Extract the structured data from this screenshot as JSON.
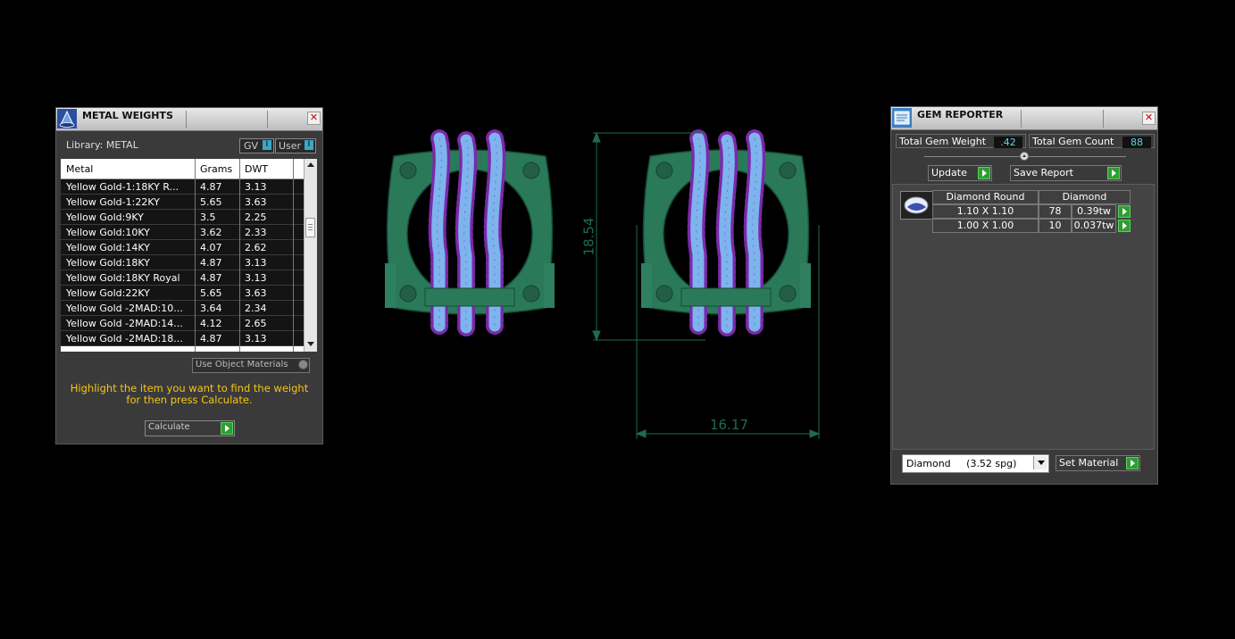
{
  "metal_panel": {
    "title": "METAL WEIGHTS",
    "library_label": "Library: METAL",
    "gv_label": "GV",
    "user_label": "User",
    "columns": [
      "Metal",
      "Grams",
      "DWT"
    ],
    "rows": [
      {
        "metal": "Yellow Gold-1:18KY R...",
        "grams": "4.87",
        "dwt": "3.13"
      },
      {
        "metal": "Yellow Gold-1:22KY",
        "grams": "5.65",
        "dwt": "3.63"
      },
      {
        "metal": "Yellow Gold:9KY",
        "grams": "3.5",
        "dwt": "2.25"
      },
      {
        "metal": "Yellow Gold:10KY",
        "grams": "3.62",
        "dwt": "2.33"
      },
      {
        "metal": "Yellow Gold:14KY",
        "grams": "4.07",
        "dwt": "2.62"
      },
      {
        "metal": "Yellow Gold:18KY",
        "grams": "4.87",
        "dwt": "3.13"
      },
      {
        "metal": "Yellow Gold:18KY Royal",
        "grams": "4.87",
        "dwt": "3.13"
      },
      {
        "metal": "Yellow Gold:22KY",
        "grams": "5.65",
        "dwt": "3.63"
      },
      {
        "metal": "Yellow Gold -2MAD:10...",
        "grams": "3.64",
        "dwt": "2.34"
      },
      {
        "metal": "Yellow Gold -2MAD:14...",
        "grams": "4.12",
        "dwt": "2.65"
      },
      {
        "metal": "Yellow Gold -2MAD:18...",
        "grams": "4.87",
        "dwt": "3.13"
      }
    ],
    "use_object_materials": "Use Object Materials",
    "instruction": "Highlight the item you want to find the weight for then press Calculate.",
    "calculate_label": "Calculate",
    "accent_color": "#f5c518"
  },
  "viewport": {
    "height_dimension": "18.54",
    "width_dimension": "16.17",
    "metal_color": "#2a7a5a",
    "gem_color": "#7fb3ee",
    "prong_color": "#7a2aa8",
    "dimension_color": "#1e6b4f"
  },
  "gem_panel": {
    "title": "GEM REPORTER",
    "total_weight_label": "Total Gem Weight",
    "total_weight_value": ".42",
    "total_count_label": "Total Gem Count",
    "total_count_value": "88",
    "update_label": "Update",
    "save_report_label": "Save Report",
    "table_header_shape": "Diamond Round",
    "table_header_material": "Diamond",
    "rows": [
      {
        "size": "1.10 X 1.10",
        "count": "78",
        "weight": "0.39tw"
      },
      {
        "size": "1.00 X 1.00",
        "count": "10",
        "weight": "0.037tw"
      }
    ],
    "material_select": "Diamond     (3.52 spg)",
    "set_material_label": "Set Material"
  }
}
